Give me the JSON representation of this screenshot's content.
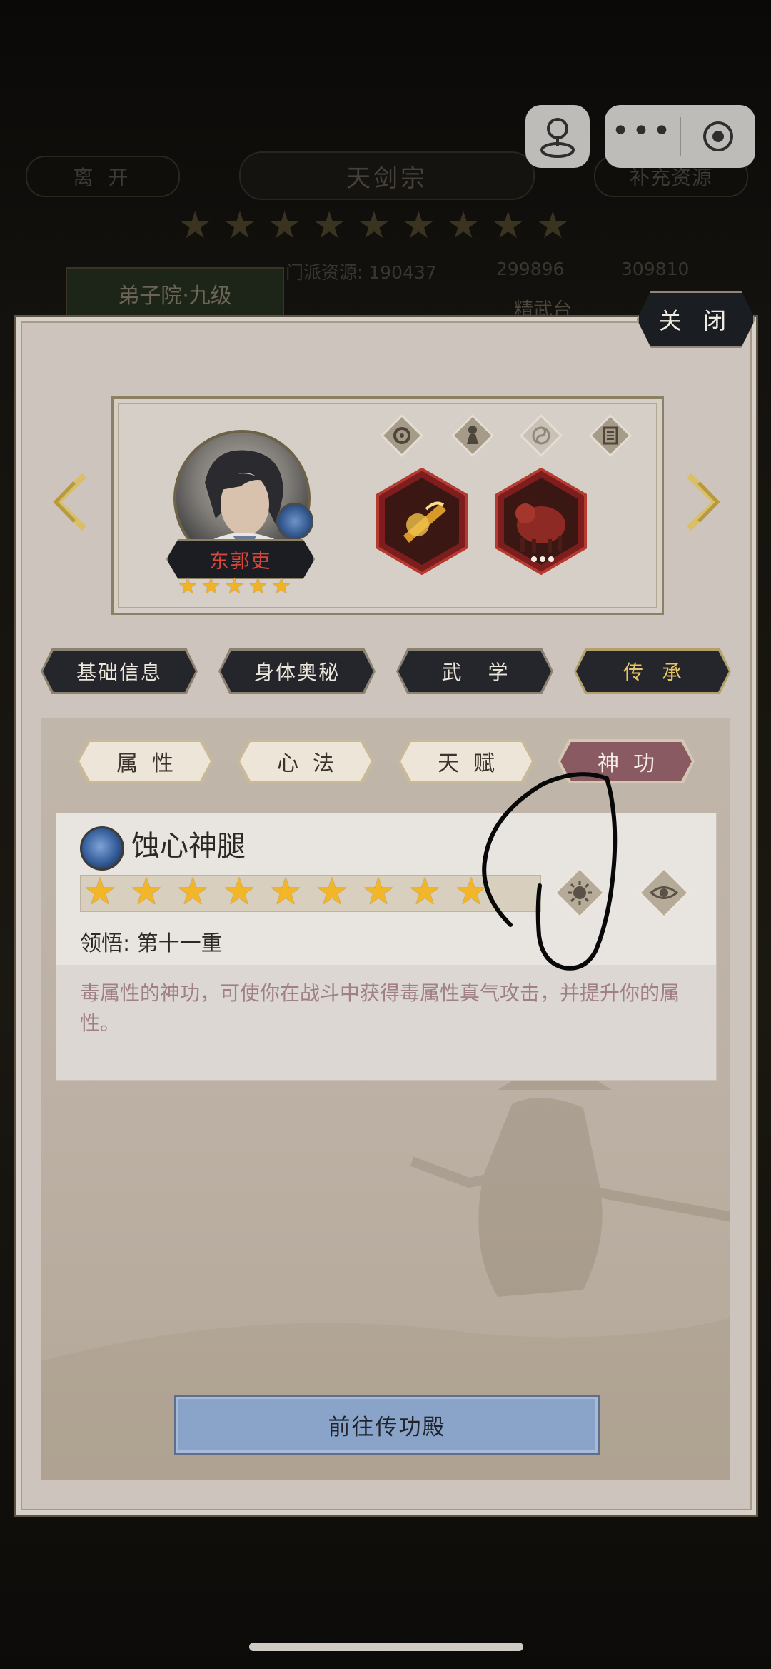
{
  "background": {
    "leave_label": "离 开",
    "sect_title": "天剑宗",
    "replenish_label": "补充资源",
    "resource_text": "门派资源: 190437",
    "resource_2": "299896",
    "resource_3": "309810",
    "building_tag": "弟子院·九级",
    "building_tag_2": "精武台",
    "sect_stars": [
      "★",
      "★",
      "★",
      "★",
      "★",
      "★",
      "★",
      "★",
      "★"
    ]
  },
  "dialog": {
    "close_label": "关 闭"
  },
  "hero": {
    "name": "东郭吏",
    "stars": [
      "★",
      "★",
      "★",
      "★",
      "★"
    ]
  },
  "main_tabs": [
    {
      "label": "基础信息"
    },
    {
      "label": "身体奥秘"
    },
    {
      "label": "武 学"
    },
    {
      "label": "传承"
    }
  ],
  "sub_tabs": [
    {
      "label": "属性"
    },
    {
      "label": "心法"
    },
    {
      "label": "天赋"
    },
    {
      "label": "神功"
    }
  ],
  "skill": {
    "name": "蚀心神腿",
    "stars": [
      "★",
      "★",
      "★",
      "★",
      "★",
      "★",
      "★",
      "★",
      "★"
    ],
    "realm": "领悟: 第十一重",
    "description": "毒属性的神功，可使你在战斗中获得毒属性真气攻击，并提升你的属性。"
  },
  "go_button_label": "前往传功殿",
  "colors": {
    "panel": "#cdc5bd",
    "star": "#f2b628",
    "active_sub_tab": "#8a5a62",
    "go_button": "#8aa3c9"
  }
}
